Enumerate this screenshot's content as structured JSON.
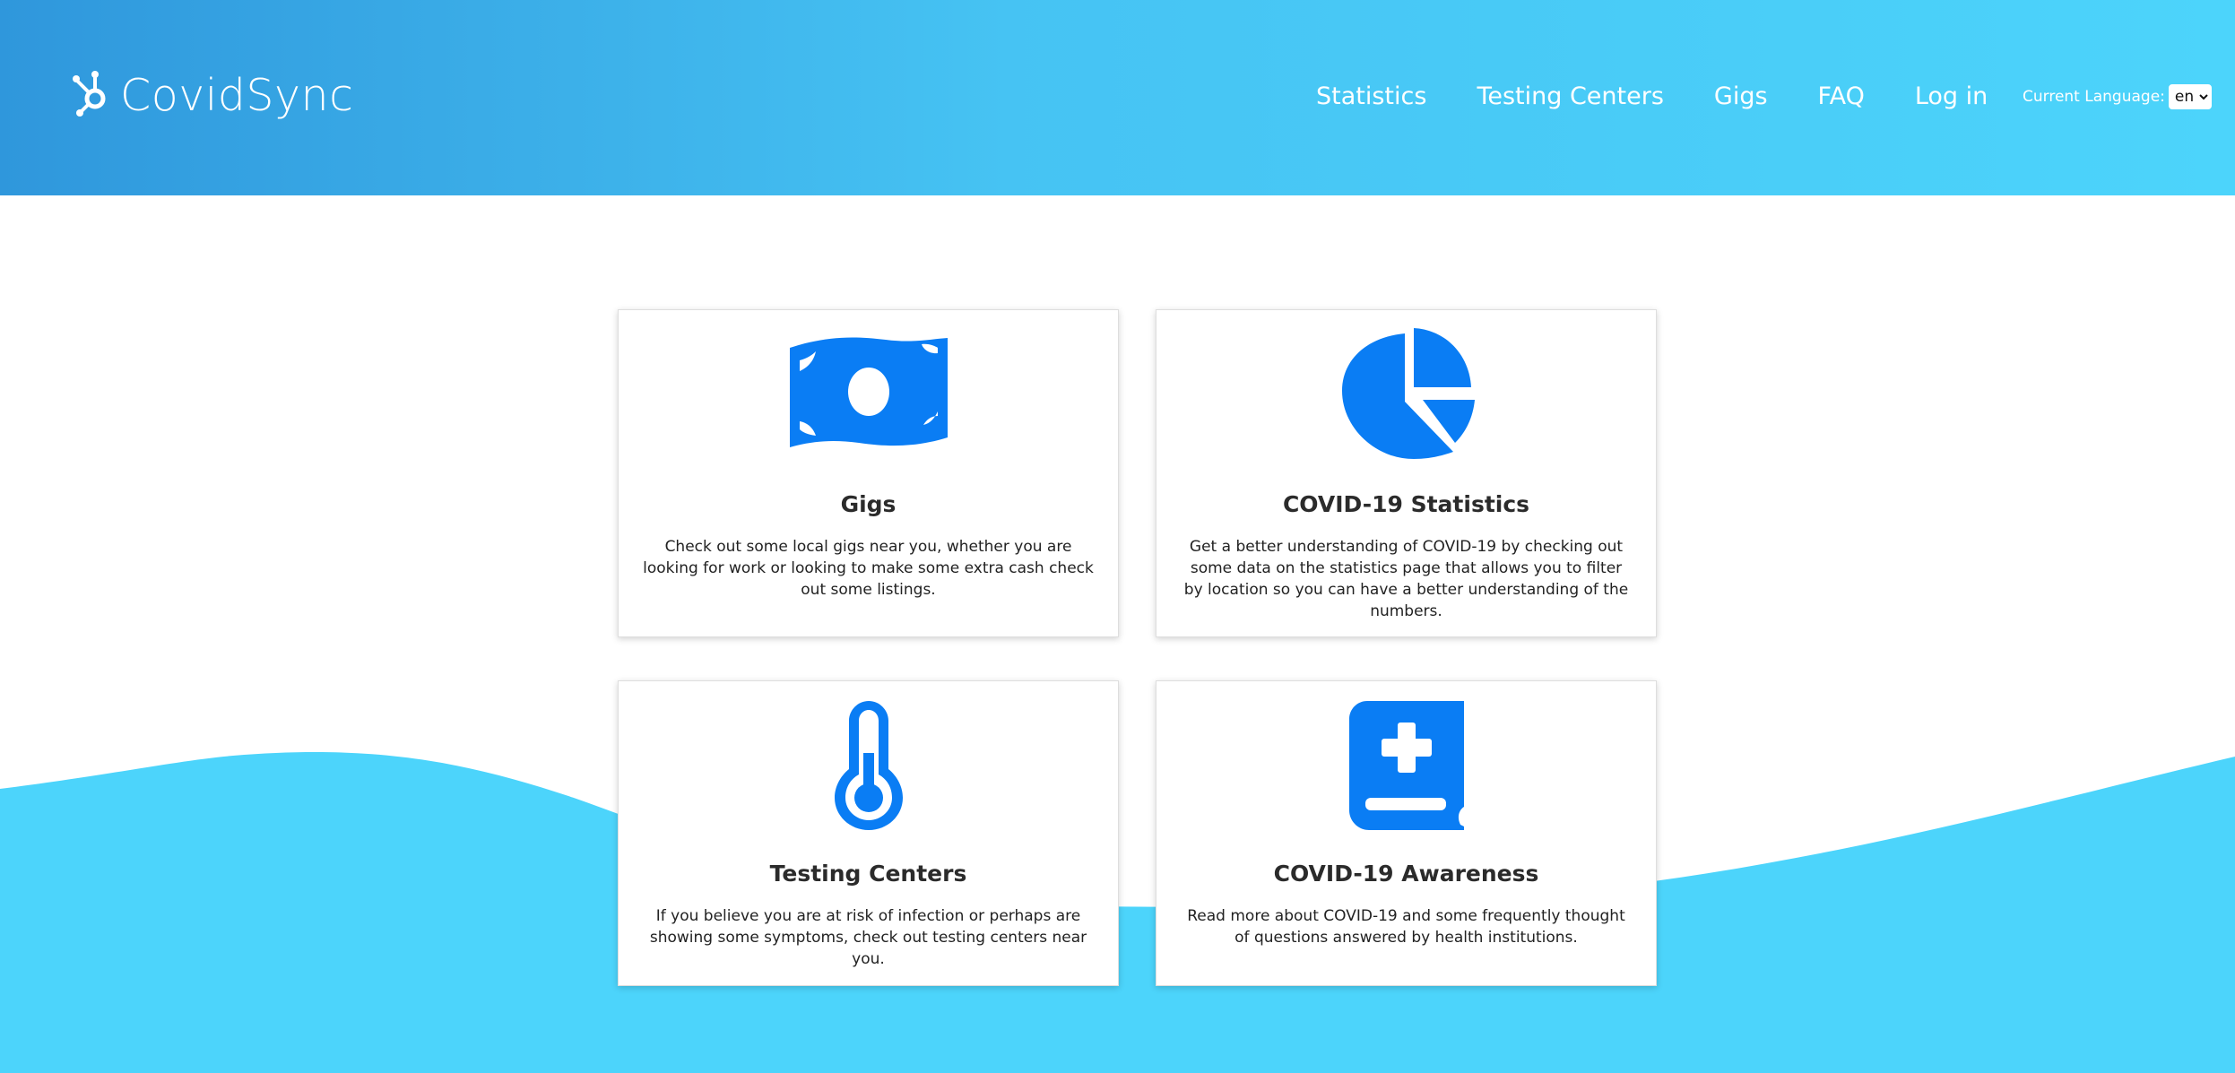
{
  "header": {
    "brand": "CovidSync",
    "nav": [
      "Statistics",
      "Testing Centers",
      "Gigs",
      "FAQ",
      "Log in"
    ],
    "language_label": "Current Language:",
    "language_value": "en",
    "colors": {
      "start": "#2f97dc",
      "end": "#4cd4fb"
    }
  },
  "cards": [
    {
      "icon": "money-bill-icon",
      "title": "Gigs",
      "text": "Check out some local gigs near you, whether you are looking for work or looking to make some extra cash check out some listings."
    },
    {
      "icon": "pie-chart-icon",
      "title": "COVID-19 Statistics",
      "text": "Get a better understanding of COVID-19 by checking out some data on the statistics page that allows you to filter by location so you can have a better understanding of the numbers."
    },
    {
      "icon": "thermometer-icon",
      "title": "Testing Centers",
      "text": "If you believe you are at risk of infection or perhaps are showing some symptoms, check out testing centers near you."
    },
    {
      "icon": "medical-book-icon",
      "title": "COVID-19 Awareness",
      "text": "Read more about COVID-19 and some frequently thought of questions answered by health institutions."
    }
  ],
  "colors": {
    "accent": "#0a7df4",
    "wave": "#4cd4fb"
  }
}
